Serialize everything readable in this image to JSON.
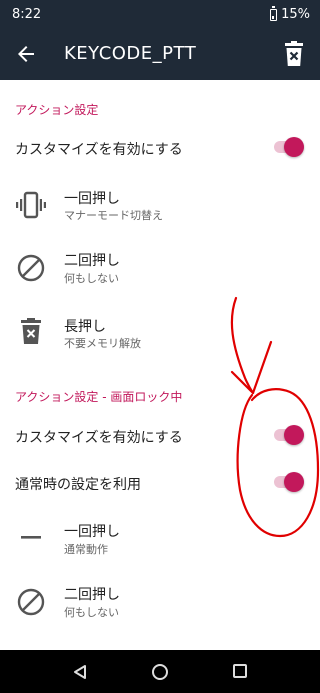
{
  "status": {
    "time": "8:22",
    "battery": "15%"
  },
  "appbar": {
    "title": "KEYCODE_PTT"
  },
  "section1": {
    "header": "アクション設定",
    "customize_label": "カスタマイズを有効にする",
    "customize_on": true,
    "items": [
      {
        "title": "一回押し",
        "subtitle": "マナーモード切替え",
        "icon": "vibrate-icon"
      },
      {
        "title": "二回押し",
        "subtitle": "何もしない",
        "icon": "block-icon"
      },
      {
        "title": "長押し",
        "subtitle": "不要メモリ解放",
        "icon": "trash-icon"
      }
    ]
  },
  "section2": {
    "header": "アクション設定 - 画面ロック中",
    "customize_label": "カスタマイズを有効にする",
    "customize_on": true,
    "normal_label": "通常時の設定を利用",
    "normal_on": true,
    "items": [
      {
        "title": "一回押し",
        "subtitle": "通常動作",
        "icon": "minus-icon"
      },
      {
        "title": "二回押し",
        "subtitle": "何もしない",
        "icon": "block-icon"
      }
    ]
  },
  "colors": {
    "appbar": "#1f2a37",
    "accent": "#c2185b",
    "annotation": "#e00000"
  }
}
